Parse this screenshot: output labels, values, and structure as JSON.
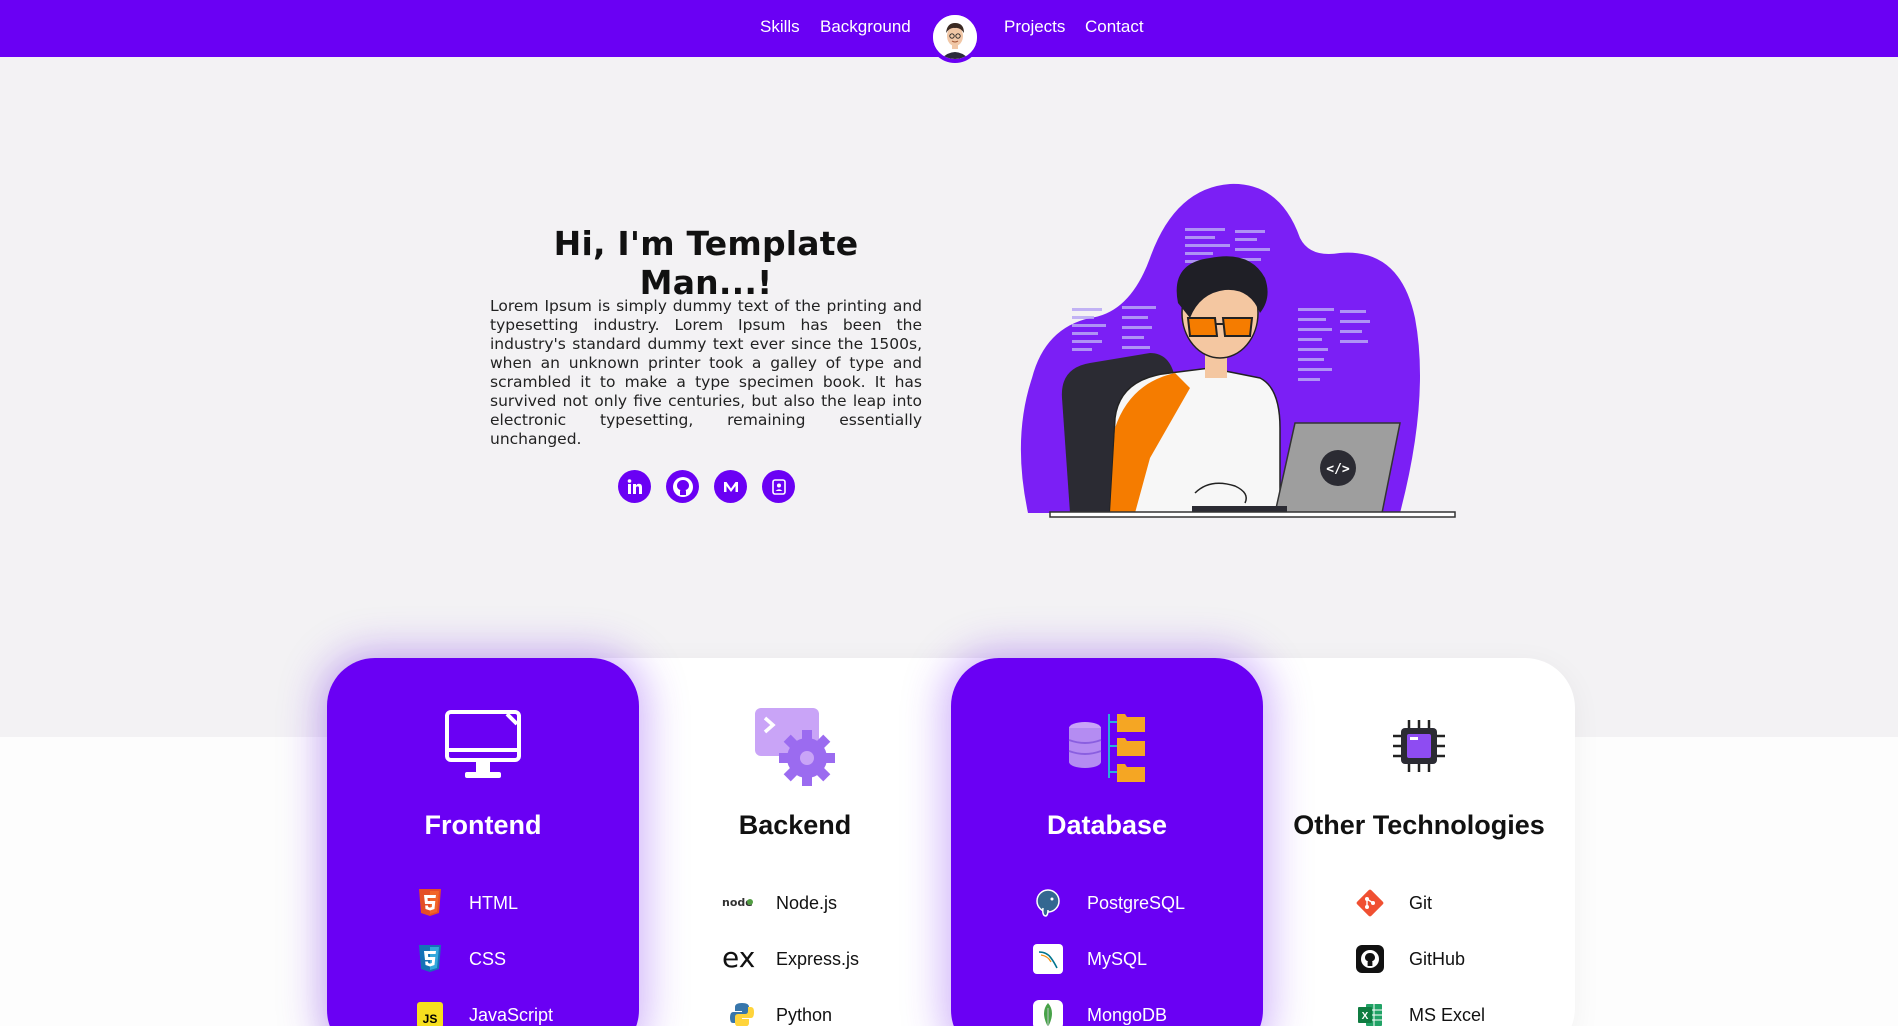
{
  "nav": {
    "left_links": [
      "Skills",
      "Background"
    ],
    "right_links": [
      "Projects",
      "Contact"
    ]
  },
  "hero": {
    "title": "Hi, I'm Template Man...!",
    "text": "Lorem Ipsum is simply dummy text of the printing and typesetting industry. Lorem Ipsum has been the industry's standard dummy text ever since the 1500s, when an unknown printer took a galley of type and scrambled it to make a type specimen book. It has survived not only five centuries, but also the leap into electronic typesetting, remaining essentially unchanged.",
    "socials": [
      "linkedin-icon",
      "github-icon",
      "medium-icon",
      "contact-card-icon"
    ]
  },
  "skills": [
    {
      "title": "Frontend",
      "icon": "monitor-icon",
      "items": [
        {
          "label": "HTML",
          "icon": "html5-icon"
        },
        {
          "label": "CSS",
          "icon": "css3-icon"
        },
        {
          "label": "JavaScript",
          "icon": "javascript-icon"
        }
      ]
    },
    {
      "title": "Backend",
      "icon": "terminal-gear-icon",
      "items": [
        {
          "label": "Node.js",
          "icon": "nodejs-icon"
        },
        {
          "label": "Express.js",
          "icon": "express-icon"
        },
        {
          "label": "Python",
          "icon": "python-icon"
        }
      ]
    },
    {
      "title": "Database",
      "icon": "database-folders-icon",
      "items": [
        {
          "label": "PostgreSQL",
          "icon": "postgresql-icon"
        },
        {
          "label": "MySQL",
          "icon": "mysql-icon"
        },
        {
          "label": "MongoDB",
          "icon": "mongodb-icon"
        }
      ]
    },
    {
      "title": "Other Technologies",
      "icon": "chip-icon",
      "items": [
        {
          "label": "Git",
          "icon": "git-icon"
        },
        {
          "label": "GitHub",
          "icon": "github-icon"
        },
        {
          "label": "MS Excel",
          "icon": "excel-icon"
        }
      ]
    }
  ],
  "colors": {
    "primary": "#6a00f4",
    "background": "#f3f2f4",
    "accent_orange": "#f57c00"
  }
}
